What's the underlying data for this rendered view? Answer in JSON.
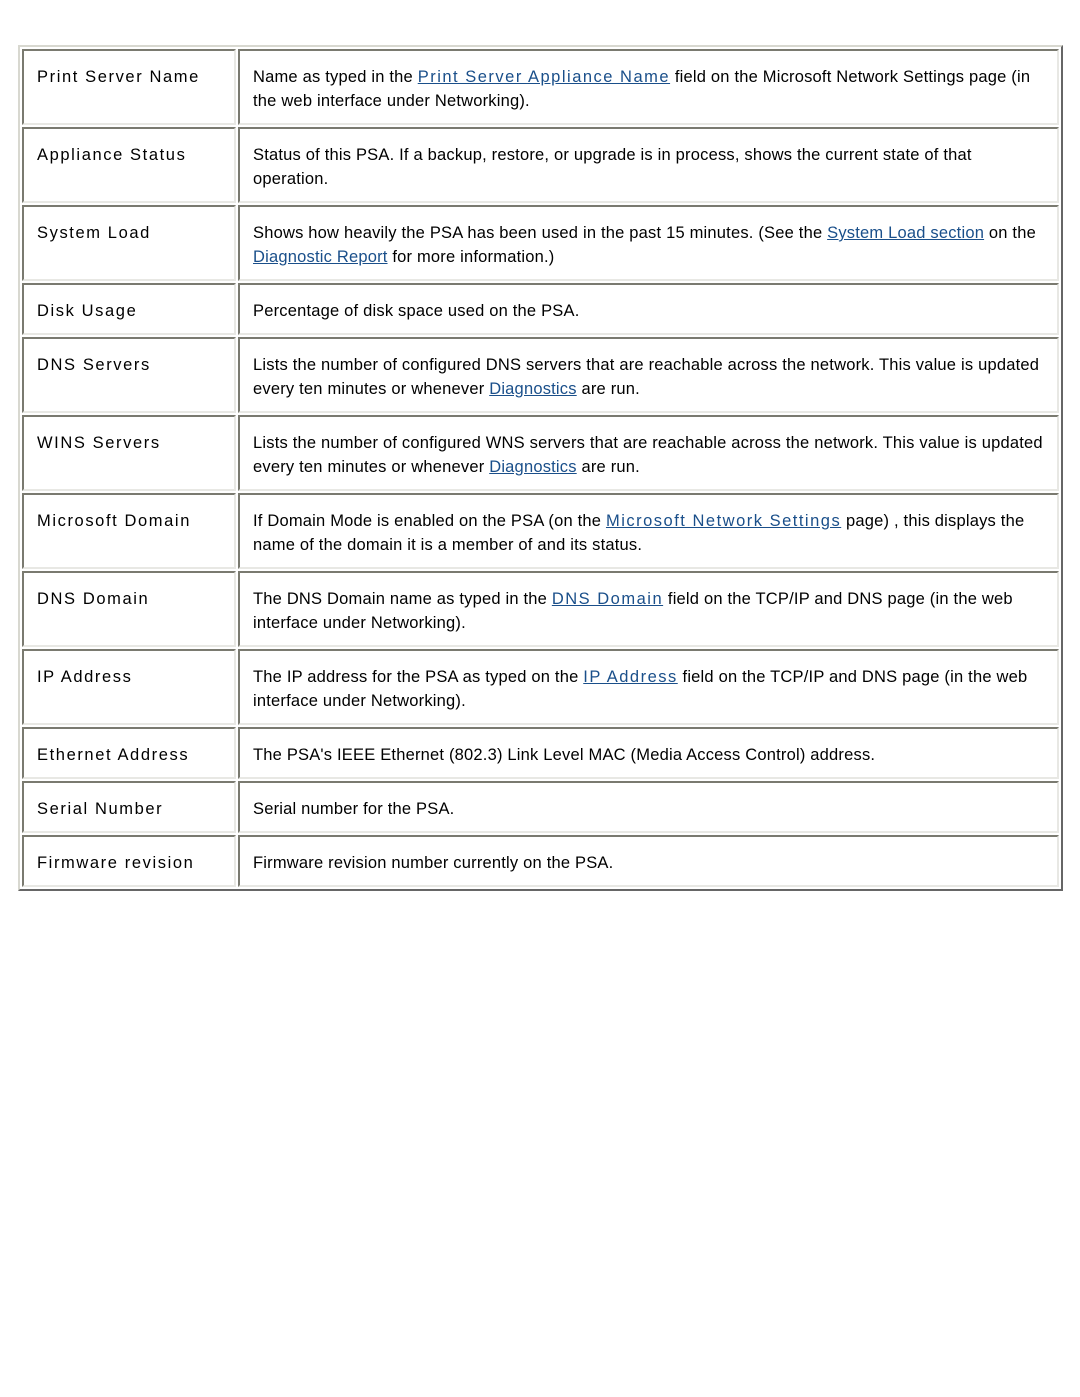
{
  "rows": [
    {
      "term": "Print Server Name",
      "desc": {
        "pre": "Name as typed in the ",
        "link1": "Print Server Appliance Name",
        "mid": " field on the Microsoft Network Settings page (in the web interface under Networking)."
      }
    },
    {
      "term": "Appliance Status",
      "desc": {
        "text": "Status of this PSA. If a backup, restore, or upgrade is in process, shows the current state of that operation."
      }
    },
    {
      "term": "System Load",
      "desc": {
        "pre": "Shows how heavily the PSA has been used in the past 15 minutes. (See the ",
        "link1": "System Load section",
        "mid": " on the ",
        "link2": "Diagnostic Report",
        "post": " for more information.)"
      }
    },
    {
      "term": "Disk Usage",
      "desc": {
        "text": "Percentage of disk space used on the PSA."
      }
    },
    {
      "term": "DNS Servers",
      "desc": {
        "pre": "Lists the number of configured DNS servers that are reachable across the network. This value is updated every ten minutes or whenever ",
        "link1": "Diagnostics",
        "mid": " are run."
      }
    },
    {
      "term": "WINS Servers",
      "desc": {
        "pre": "Lists the number of configured WNS servers that are reachable across the network. This value is updated every ten minutes or whenever ",
        "link1": "Diagnostics",
        "mid": " are run."
      }
    },
    {
      "term": "Microsoft Domain",
      "desc": {
        "pre": "If Domain Mode is enabled on the PSA (on the ",
        "link1": "Microsoft Network Settings",
        "mid": " page) , this displays the name of the domain it is a member of and its status."
      }
    },
    {
      "term": "DNS Domain",
      "desc": {
        "pre": "The DNS Domain name as typed in the ",
        "link1": "DNS Domain",
        "mid": " field on the TCP/IP and DNS page (in the web interface under Networking)."
      }
    },
    {
      "term": "IP Address",
      "desc": {
        "pre": "The IP address for the PSA as typed on the ",
        "link1": "IP Address",
        "mid": " field on the TCP/IP and DNS page (in the web interface under Networking)."
      }
    },
    {
      "term": "Ethernet Address",
      "desc": {
        "text": "The PSA's IEEE Ethernet (802.3) Link Level MAC (Media Access Control) address."
      }
    },
    {
      "term": "Serial Number",
      "desc": {
        "text": "Serial number for the PSA."
      }
    },
    {
      "term": "Firmware revision",
      "desc": {
        "text": "Firmware revision number currently on the PSA."
      }
    }
  ],
  "colors": {
    "link": "#1a4f8a",
    "text": "#000000",
    "background": "#ffffff"
  }
}
